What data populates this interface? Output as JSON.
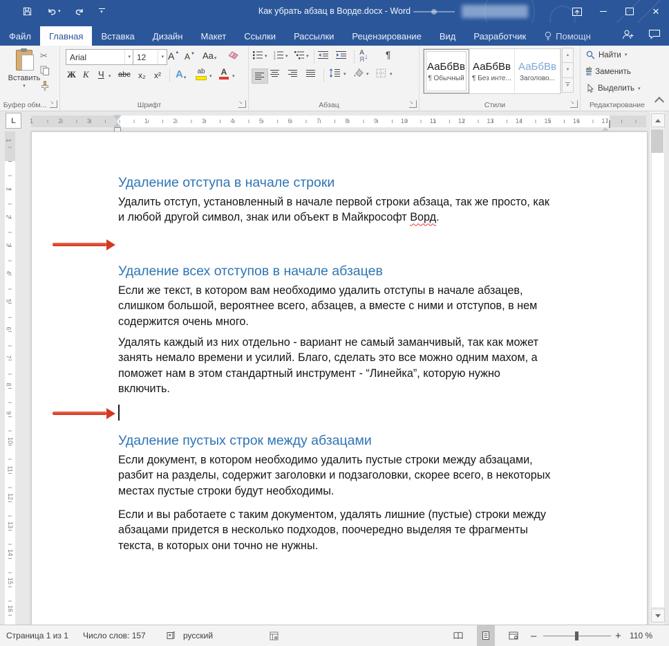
{
  "colors": {
    "accent": "#2b579a",
    "heading": "#2e74b5",
    "arrow_red": "#d23920"
  },
  "titlebar": {
    "title": "Как убрать абзац в Ворде.docx - Word"
  },
  "tabs": {
    "items": [
      {
        "label": "Файл"
      },
      {
        "label": "Главная"
      },
      {
        "label": "Вставка"
      },
      {
        "label": "Дизайн"
      },
      {
        "label": "Макет"
      },
      {
        "label": "Ссылки"
      },
      {
        "label": "Рассылки"
      },
      {
        "label": "Рецензирование"
      },
      {
        "label": "Вид"
      },
      {
        "label": "Разработчик"
      }
    ],
    "active": "Главная",
    "assistant": "Помощн"
  },
  "ribbon": {
    "clipboard": {
      "paste": "Вставить",
      "label": "Буфер обм..."
    },
    "font": {
      "family": "Arial",
      "size": "12",
      "grow": "A",
      "shrink": "A",
      "case": "Aa",
      "bold": "Ж",
      "italic": "К",
      "underline": "Ч",
      "strikethrough": "abc",
      "subscript": "x₂",
      "superscript": "x²",
      "effects": "А",
      "highlight": "ab",
      "fontcolor": "А",
      "label": "Шрифт"
    },
    "paragraph": {
      "sort_a": "А",
      "sort_z": "Я",
      "pilcrow": "¶",
      "label": "Абзац"
    },
    "styles": {
      "label": "Стили",
      "cards": [
        {
          "preview": "АаБбВв",
          "name": "¶ Обычный"
        },
        {
          "preview": "АаБбВв",
          "name": "¶ Без инте..."
        },
        {
          "preview": "АаБбВв",
          "name": "Заголово..."
        }
      ]
    },
    "editing": {
      "find": "Найти",
      "replace": "Заменить",
      "select": "Выделить",
      "replace_icon_top": "ab",
      "replace_icon_bottom": "ac",
      "label": "Редактирование"
    }
  },
  "ruler": {
    "tab_selector": "L",
    "h_margin_numbers": [
      "3",
      "2",
      "1"
    ],
    "h_numbers": [
      "1",
      "2",
      "3",
      "4",
      "5",
      "6",
      "7",
      "8",
      "9",
      "10",
      "11",
      "12",
      "13",
      "14",
      "15",
      "16"
    ],
    "h_right_number": "17",
    "v_margin_number": "1",
    "v_numbers": [
      "1",
      "2",
      "3",
      "4",
      "5",
      "6",
      "7",
      "8",
      "9",
      "10",
      "11",
      "12",
      "13",
      "14",
      "15",
      "16"
    ]
  },
  "document": {
    "h1": "Удаление отступа в начале строки",
    "p1_main": "Удалить отступ, установленный в начале первой строки абзаца, так же просто, как\nи любой другой символ, знак или объект в Майкрософт ",
    "p1_spellcheck": "Ворд",
    "p1_tail": ".",
    "h2": "Удаление всех отступов в начале абзацев",
    "p2": "Если же текст, в котором вам необходимо удалить отступы в начале абзацев,\nслишком большой, вероятнее всего, абзацев, а вместе с ними и отступов, в нем\nсодержится очень много.",
    "p3": "Удалять каждый из них отдельно - вариант не самый заманчивый, так как может\nзанять немало времени и усилий. Благо, сделать это все можно одним махом, а\nпоможет нам в этом стандартный инструмент - “Линейка”, которую нужно\nвключить.",
    "h3": "Удаление пустых строк между абзацами",
    "p4": "Если документ, в котором необходимо удалить пустые строки между абзацами,\nразбит на разделы, содержит заголовки и подзаголовки, скорее всего, в некоторых\nместах пустые строки будут необходимы.",
    "p5": "Если и вы работаете с таким документом, удалять лишние (пустые) строки между\nабзацами придется в несколько подходов, поочередно выделяя те фрагменты\nтекста, в которых они точно не нужны."
  },
  "statusbar": {
    "page": "Страница 1 из 1",
    "words": "Число слов: 157",
    "language": "русский",
    "zoom_out": "–",
    "zoom_in": "+",
    "zoom": "110 %"
  }
}
